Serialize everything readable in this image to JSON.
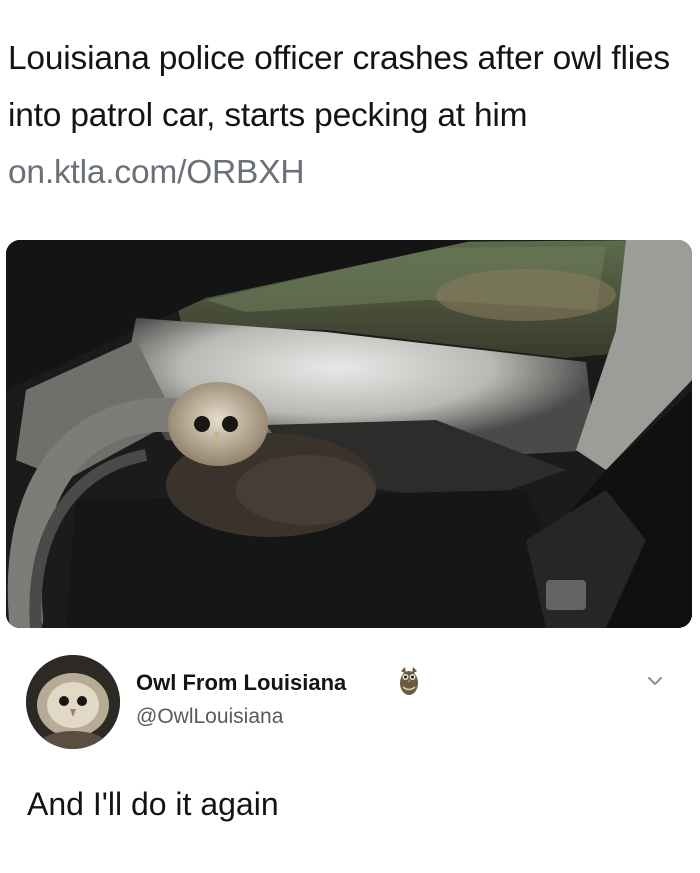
{
  "headline": {
    "text": "Louisiana police officer crashes after owl flies into patrol car, starts pecking at him",
    "link": "on.ktla.com/ORBXH"
  },
  "photo": {
    "icon": "owl-in-patrol-car-photo"
  },
  "tweet": {
    "display_name": "Owl From Louisiana",
    "handle": "@OwlLouisiana",
    "badge_icon": "owl-emoji-icon",
    "menu_icon": "chevron-down-icon",
    "text": "And I'll do it again"
  },
  "colors": {
    "text": "#141414",
    "link": "#6a7077",
    "handle": "#555b61"
  }
}
